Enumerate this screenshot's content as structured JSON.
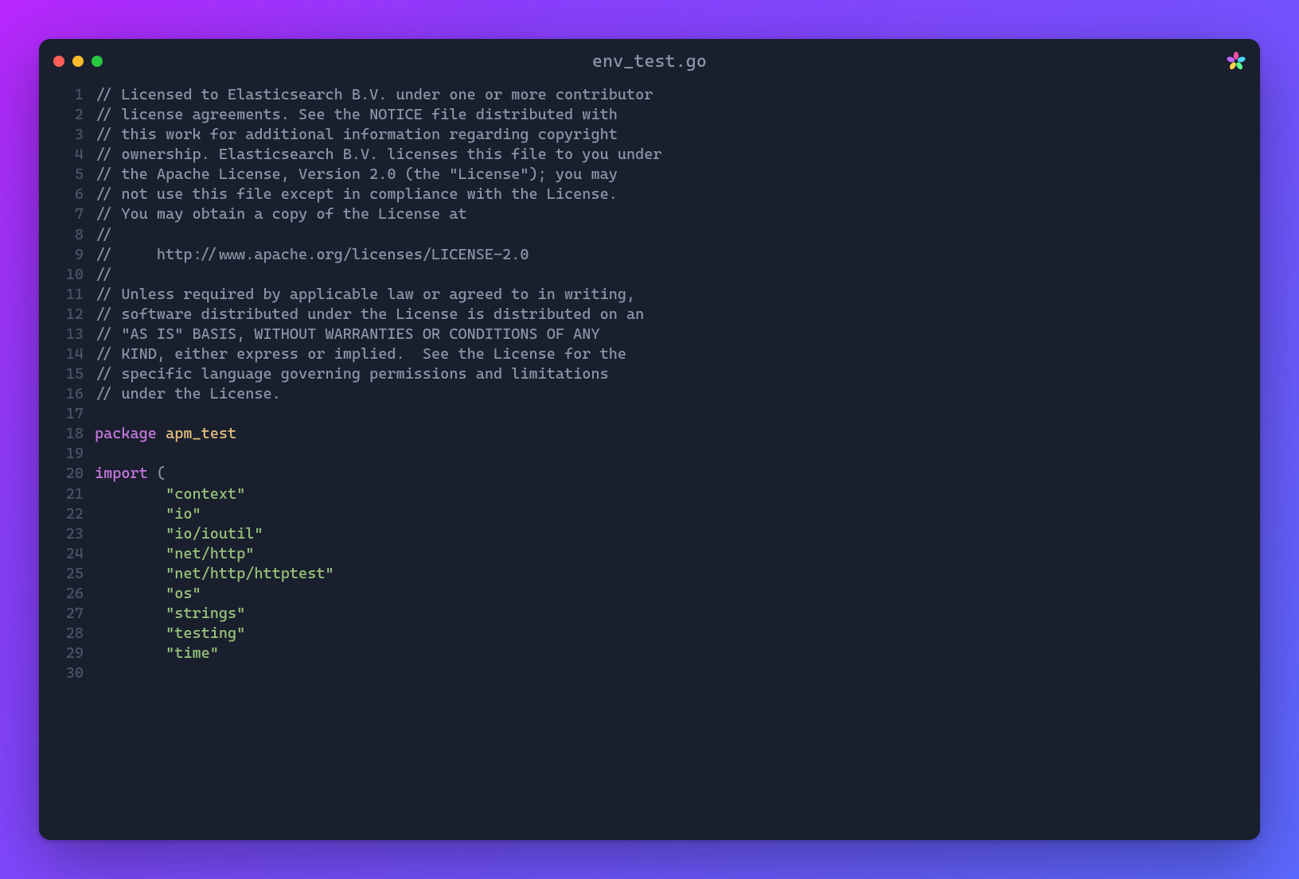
{
  "window": {
    "title": "env_test.go"
  },
  "code": {
    "lines": [
      [
        {
          "kind": "comment",
          "text": "// Licensed to Elasticsearch B.V. under one or more contributor"
        }
      ],
      [
        {
          "kind": "comment",
          "text": "// license agreements. See the NOTICE file distributed with"
        }
      ],
      [
        {
          "kind": "comment",
          "text": "// this work for additional information regarding copyright"
        }
      ],
      [
        {
          "kind": "comment",
          "text": "// ownership. Elasticsearch B.V. licenses this file to you under"
        }
      ],
      [
        {
          "kind": "comment",
          "text": "// the Apache License, Version 2.0 (the \"License\"); you may"
        }
      ],
      [
        {
          "kind": "comment",
          "text": "// not use this file except in compliance with the License."
        }
      ],
      [
        {
          "kind": "comment",
          "text": "// You may obtain a copy of the License at"
        }
      ],
      [
        {
          "kind": "comment",
          "text": "//"
        }
      ],
      [
        {
          "kind": "comment",
          "text": "//     http://www.apache.org/licenses/LICENSE-2.0"
        }
      ],
      [
        {
          "kind": "comment",
          "text": "//"
        }
      ],
      [
        {
          "kind": "comment",
          "text": "// Unless required by applicable law or agreed to in writing,"
        }
      ],
      [
        {
          "kind": "comment",
          "text": "// software distributed under the License is distributed on an"
        }
      ],
      [
        {
          "kind": "comment",
          "text": "// \"AS IS\" BASIS, WITHOUT WARRANTIES OR CONDITIONS OF ANY"
        }
      ],
      [
        {
          "kind": "comment",
          "text": "// KIND, either express or implied.  See the License for the"
        }
      ],
      [
        {
          "kind": "comment",
          "text": "// specific language governing permissions and limitations"
        }
      ],
      [
        {
          "kind": "comment",
          "text": "// under the License."
        }
      ],
      [],
      [
        {
          "kind": "keyword",
          "text": "package"
        },
        {
          "kind": "plain",
          "text": " "
        },
        {
          "kind": "ident",
          "text": "apm_test"
        }
      ],
      [],
      [
        {
          "kind": "keyword",
          "text": "import"
        },
        {
          "kind": "plain",
          "text": " ("
        }
      ],
      [
        {
          "kind": "plain",
          "text": "        "
        },
        {
          "kind": "string",
          "text": "\"context\""
        }
      ],
      [
        {
          "kind": "plain",
          "text": "        "
        },
        {
          "kind": "string",
          "text": "\"io\""
        }
      ],
      [
        {
          "kind": "plain",
          "text": "        "
        },
        {
          "kind": "string",
          "text": "\"io/ioutil\""
        }
      ],
      [
        {
          "kind": "plain",
          "text": "        "
        },
        {
          "kind": "string",
          "text": "\"net/http\""
        }
      ],
      [
        {
          "kind": "plain",
          "text": "        "
        },
        {
          "kind": "string",
          "text": "\"net/http/httptest\""
        }
      ],
      [
        {
          "kind": "plain",
          "text": "        "
        },
        {
          "kind": "string",
          "text": "\"os\""
        }
      ],
      [
        {
          "kind": "plain",
          "text": "        "
        },
        {
          "kind": "string",
          "text": "\"strings\""
        }
      ],
      [
        {
          "kind": "plain",
          "text": "        "
        },
        {
          "kind": "string",
          "text": "\"testing\""
        }
      ],
      [
        {
          "kind": "plain",
          "text": "        "
        },
        {
          "kind": "string",
          "text": "\"time\""
        }
      ],
      []
    ]
  },
  "colors": {
    "bg_gradient_start": "#b827fc",
    "bg_gradient_end": "#5b6aff",
    "editor_bg": "#1a1f2e",
    "gutter": "#4a5568",
    "comment": "#8b95a7",
    "keyword": "#c678dd",
    "ident": "#e5c07b",
    "string": "#98c379"
  }
}
